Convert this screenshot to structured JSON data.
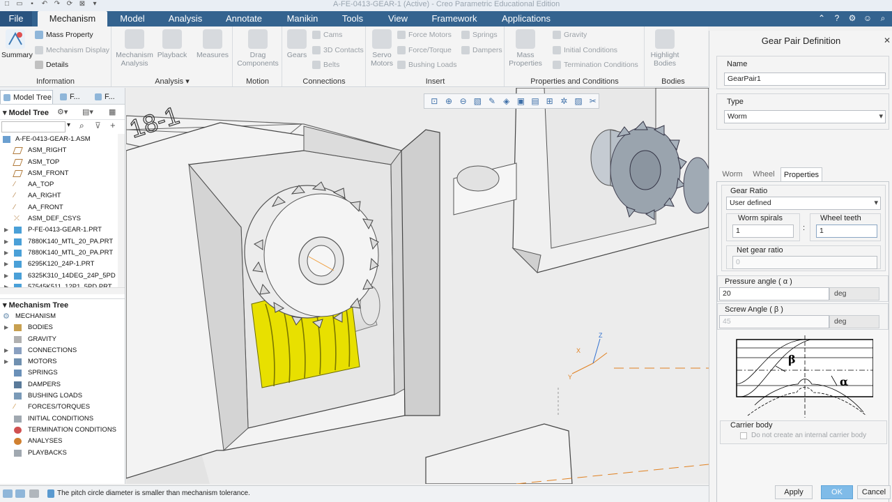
{
  "window": {
    "title": "A-FE-0413-GEAR-1 (Active) - Creo Parametric Educational Edition"
  },
  "tabs": [
    "File",
    "Mechanism",
    "Model",
    "Analysis",
    "Annotate",
    "Manikin",
    "Tools",
    "View",
    "Framework",
    "Applications"
  ],
  "ribbon": {
    "information": {
      "label": "Information",
      "summary": "Summary",
      "mass_property": "Mass Property",
      "mechanism_display": "Mechanism Display",
      "details": "Details"
    },
    "analysis": {
      "label": "Analysis",
      "mechanism_analysis": "Mechanism Analysis",
      "playback": "Playback",
      "measures": "Measures"
    },
    "motion": {
      "label": "Motion",
      "drag_components": "Drag Components"
    },
    "connections": {
      "label": "Connections",
      "gears": "Gears",
      "cams": "Cams",
      "contacts_3d": "3D Contacts",
      "belts": "Belts"
    },
    "insert": {
      "label": "Insert",
      "servo_motors": "Servo Motors",
      "force_motors": "Force Motors",
      "force_torque": "Force/Torque",
      "bushing_loads": "Bushing Loads",
      "springs": "Springs",
      "dampers": "Dampers"
    },
    "properties": {
      "label": "Properties and Conditions",
      "mass_properties": "Mass Properties",
      "gravity": "Gravity",
      "initial_conditions": "Initial Conditions",
      "termination_conditions": "Termination Conditions"
    },
    "bodies": {
      "label": "Bodies",
      "highlight_bodies": "Highlight Bodies"
    }
  },
  "left_panel": {
    "tabs": [
      "Model Tree",
      "F...",
      "F..."
    ],
    "model_tree_label": "Model Tree",
    "model_tree_items": [
      "A-FE-0413-GEAR-1.ASM",
      "ASM_RIGHT",
      "ASM_TOP",
      "ASM_FRONT",
      "AA_TOP",
      "AA_RIGHT",
      "AA_FRONT",
      "ASM_DEF_CSYS",
      "P-FE-0413-GEAR-1.PRT",
      "7880K140_MTL_20_PA.PRT",
      "7880K140_MTL_20_PA.PRT",
      "6295K120_24P-1.PRT",
      "6325K310_14DEG_24P_5PD",
      "57545K511_12P1_5PD.PRT"
    ],
    "mechanism_tree_label": "Mechanism Tree",
    "mechanism_tree_items": [
      "MECHANISM",
      "BODIES",
      "GRAVITY",
      "CONNECTIONS",
      "MOTORS",
      "SPRINGS",
      "DAMPERS",
      "BUSHING LOADS",
      "FORCES/TORQUES",
      "INITIAL CONDITIONS",
      "TERMINATION CONDITIONS",
      "ANALYSES",
      "PLAYBACKS"
    ]
  },
  "viewport": {
    "label_text": "18-1",
    "axis_x": "X",
    "axis_y": "Y",
    "axis_z": "Z"
  },
  "dialog": {
    "title": "Gear Pair Definition",
    "name_label": "Name",
    "name_value": "GearPair1",
    "type_label": "Type",
    "type_value": "Worm",
    "tabs": [
      "Worm",
      "Wheel",
      "Properties"
    ],
    "gear_ratio_label": "Gear Ratio",
    "gear_ratio_value": "User defined",
    "worm_spirals_label": "Worm spirals",
    "worm_spirals_value": "1",
    "colon": ":",
    "wheel_teeth_label": "Wheel teeth",
    "wheel_teeth_value": "1",
    "net_gear_ratio_label": "Net gear ratio",
    "net_gear_ratio_value": "0",
    "pressure_angle_label": "Pressure angle ( α )",
    "pressure_angle_value": "20",
    "pressure_angle_unit": "deg",
    "screw_angle_label": "Screw Angle ( β )",
    "screw_angle_value": "45",
    "screw_angle_unit": "deg",
    "diagram_beta": "β",
    "diagram_alpha": "α",
    "carrier_body_label": "Carrier body",
    "carrier_body_checkbox": "Do not create an internal carrier body",
    "apply": "Apply",
    "ok": "OK",
    "cancel": "Cancel"
  },
  "status": {
    "message": "The pitch circle diameter is smaller than mechanism tolerance."
  }
}
